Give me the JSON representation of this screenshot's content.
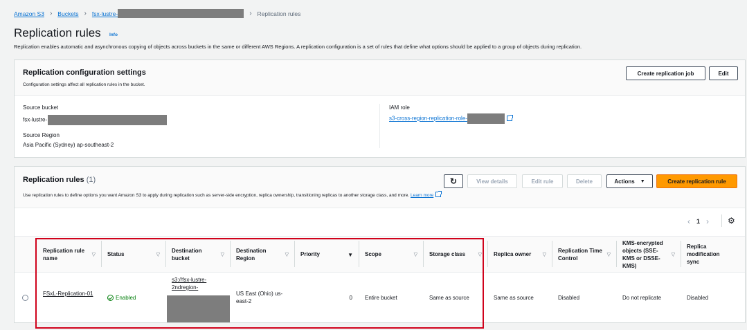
{
  "breadcrumb": {
    "items": [
      "Amazon S3",
      "Buckets",
      "fsx-lustre-"
    ],
    "current": "Replication rules"
  },
  "page": {
    "title": "Replication rules",
    "info": "Info",
    "description": "Replication enables automatic and asynchronous copying of objects across buckets in the same or different AWS Regions. A replication configuration is a set of rules that define what options should be applied to a group of objects during replication."
  },
  "config": {
    "title": "Replication configuration settings",
    "subtitle": "Configuration settings affect all replication rules in the bucket.",
    "create_job_button": "Create replication job",
    "edit_button": "Edit",
    "source_bucket_label": "Source bucket",
    "source_bucket_value": "fsx-lustre-",
    "source_region_label": "Source Region",
    "source_region_value": "Asia Pacific (Sydney) ap-southeast-2",
    "iam_role_label": "IAM role",
    "iam_role_value": "s3-cross-region-replication-role-"
  },
  "rules": {
    "title": "Replication rules",
    "count": "(1)",
    "description": "Use replication rules to define options you want Amazon S3 to apply during replication such as server-side encryption, replica ownership, transitioning replicas to another storage class, and more.",
    "learn_more": "Learn more",
    "buttons": {
      "view_details": "View details",
      "edit_rule": "Edit rule",
      "delete": "Delete",
      "actions": "Actions",
      "create": "Create replication rule"
    },
    "page_number": "1",
    "columns": [
      "Replication rule name",
      "Status",
      "Destination bucket",
      "Destination Region",
      "Priority",
      "Scope",
      "Storage class",
      "Replica owner",
      "Replication Time Control",
      "KMS-encrypted objects (SSE-KMS or DSSE-KMS)",
      "Replica modification sync"
    ],
    "row": {
      "name": "FSxL-Replication-01",
      "status": "Enabled",
      "destination_bucket": "s3://fsx-lustre-2ndregion-",
      "destination_region": "US East (Ohio) us-east-2",
      "priority": "0",
      "scope": "Entire bucket",
      "storage_class": "Same as source",
      "replica_owner": "Same as source",
      "rtc": "Disabled",
      "kms": "Do not replicate",
      "mod_sync": "Disabled"
    }
  },
  "colors": {
    "link": "#0972d3",
    "primary_button": "#ff9900",
    "enabled_status": "#037f0c",
    "highlight_box": "#d0021b"
  }
}
